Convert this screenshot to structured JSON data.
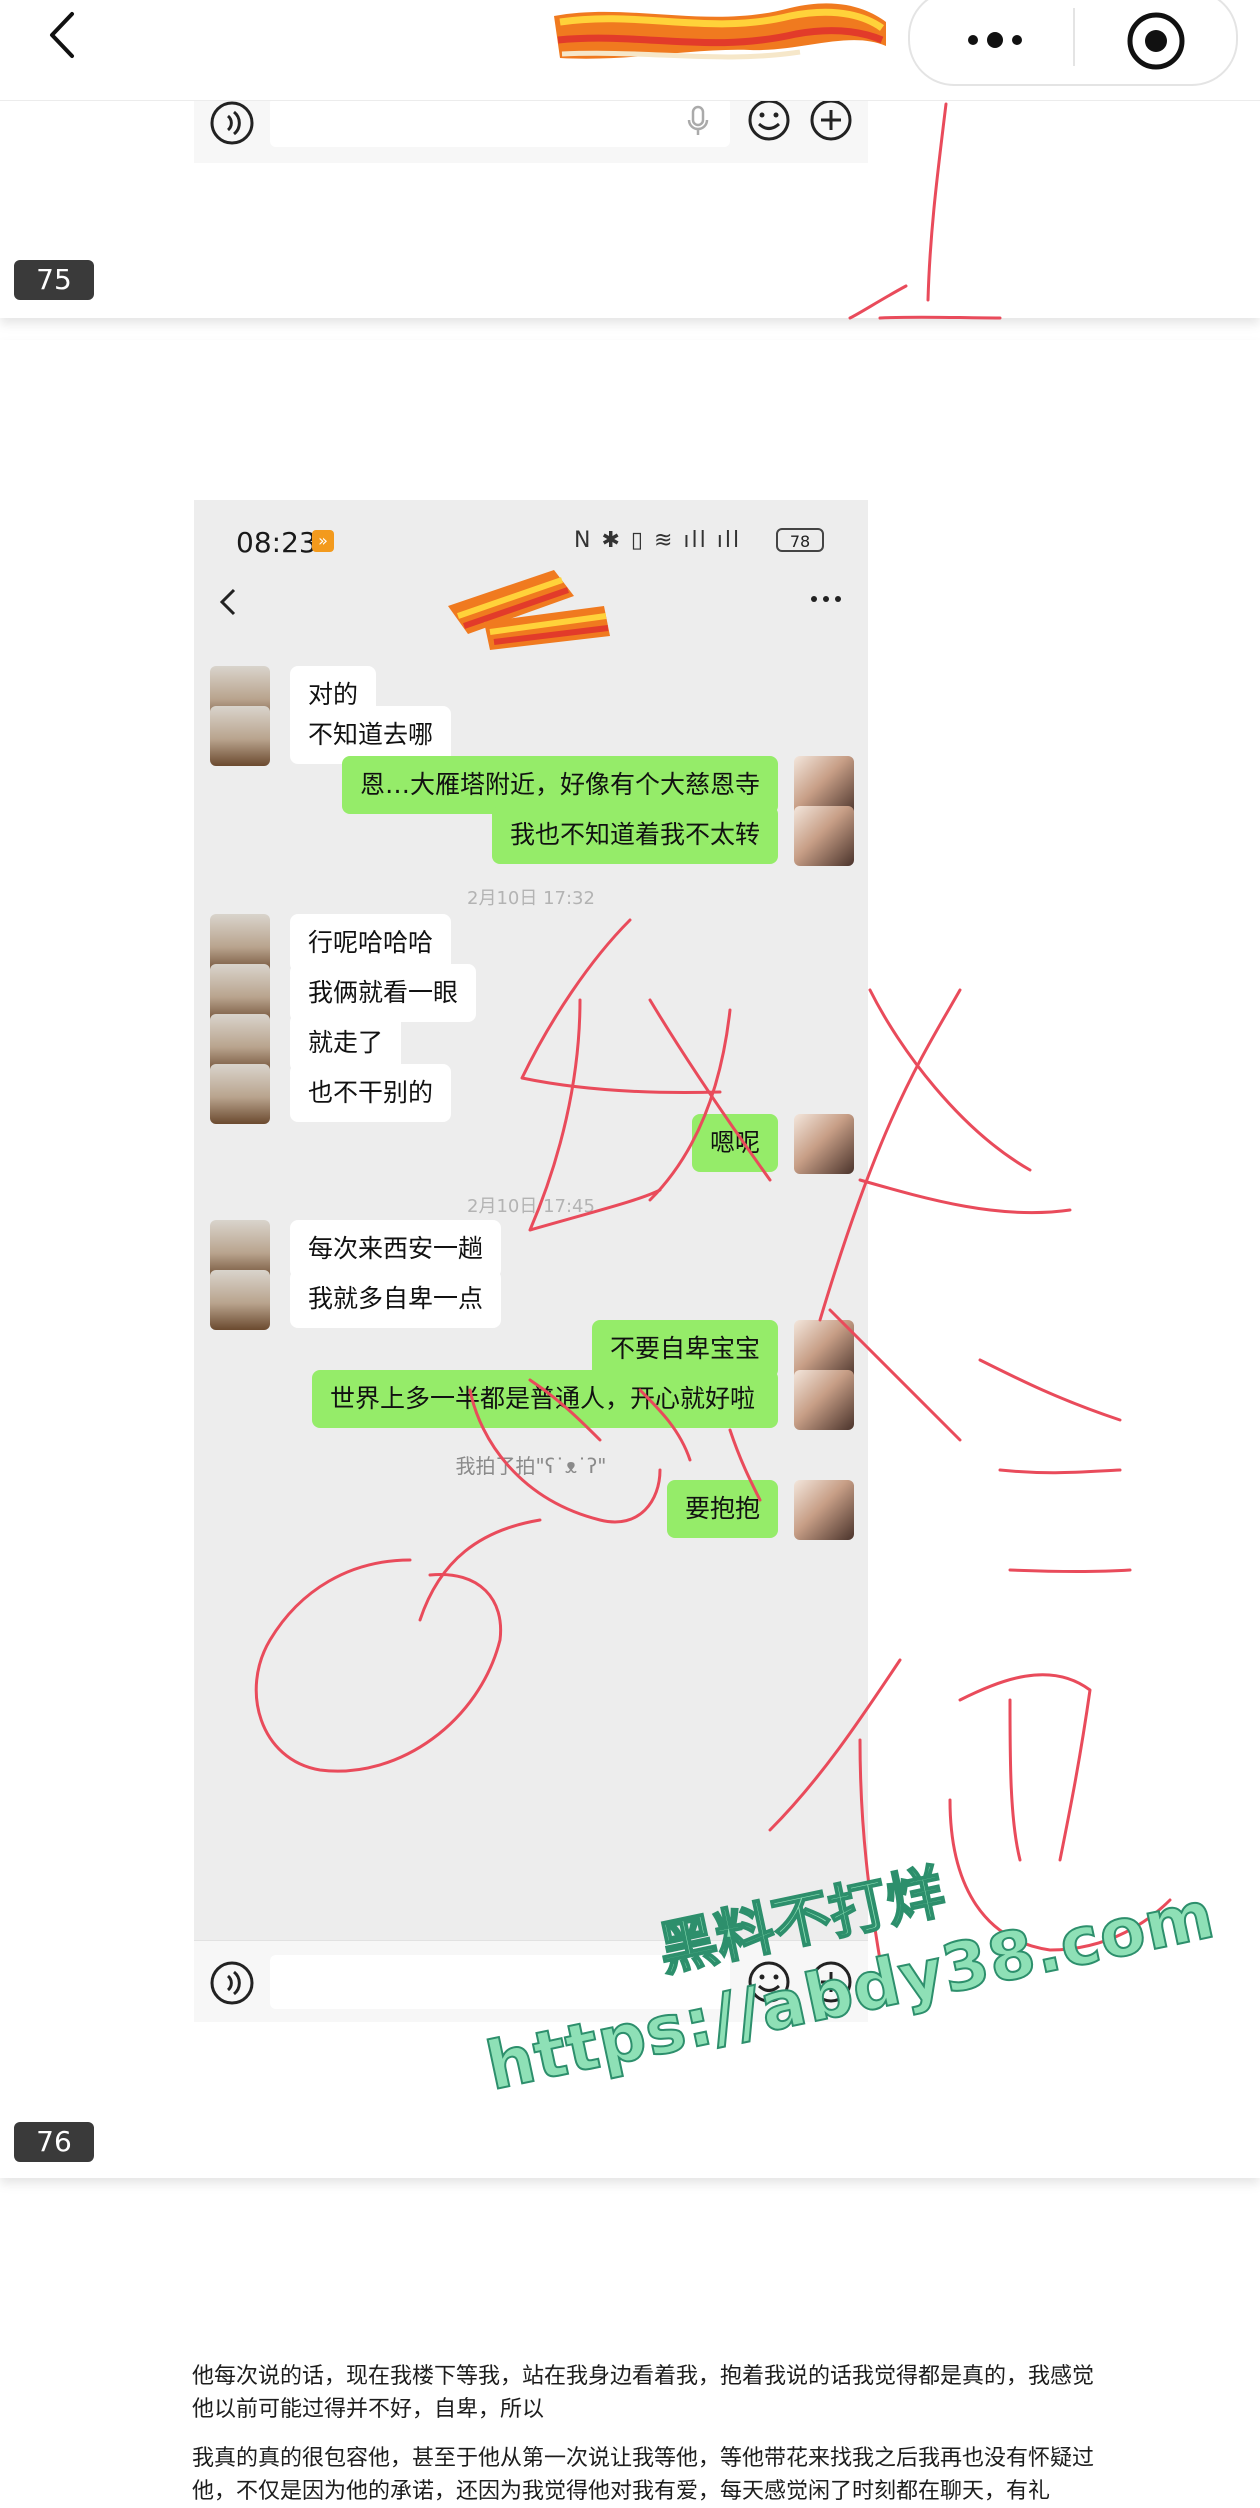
{
  "nav": {
    "back_icon": "chevron-left-icon",
    "more_icon": "more-dots-icon",
    "target_icon": "target-circle-icon"
  },
  "slide75": {
    "page_number": "75"
  },
  "slide76": {
    "page_number": "76",
    "status_time": "08:23",
    "status_icons": "N ✱ ▯ ≋ ıll ıll",
    "battery": "78",
    "messages": [
      {
        "side": "other",
        "text": "对的"
      },
      {
        "side": "other",
        "text": "不知道去哪"
      },
      {
        "side": "self",
        "text": "恩…大雁塔附近，好像有个大慈恩寺"
      },
      {
        "side": "self",
        "text": "我也不知道着我不太转"
      },
      {
        "type": "time",
        "text": "2月10日 17:32"
      },
      {
        "side": "other",
        "text": "行呢哈哈哈"
      },
      {
        "side": "other",
        "text": "我俩就看一眼"
      },
      {
        "side": "other",
        "text": "就走了"
      },
      {
        "side": "other",
        "text": "也不干别的"
      },
      {
        "side": "self",
        "text": "嗯呢"
      },
      {
        "type": "time",
        "text": "2月10日 17:45"
      },
      {
        "side": "other",
        "text": "每次来西安一趟"
      },
      {
        "side": "other",
        "text": "我就多自卑一点"
      },
      {
        "side": "self",
        "text": "不要自卑宝宝"
      },
      {
        "side": "self",
        "text": "世界上多一半都是普通人，开心就好啦"
      },
      {
        "type": "pat",
        "text": "我拍了拍\"ʕ˙ᴥ˙ʔ\""
      },
      {
        "side": "self",
        "text": "要抱抱"
      }
    ]
  },
  "watermark": {
    "line1": "黑料不打烊",
    "line2": "https://abdy38.com"
  },
  "article": {
    "p1": "他每次说的话，现在我楼下等我，站在我身边看着我，抱着我说的话我觉得都是真的，我感觉他以前可能过得并不好，自卑，所以",
    "p2": "我真的真的很包容他，甚至于他从第一次说让我等他，等他带花来找我之后我再也没有怀疑过他，不仅是因为他的承诺，还因为我觉得他对我有爱，每天感觉闲了时刻都在聊天，有礼"
  },
  "colors": {
    "bubble_green": "#95ec69",
    "chat_bg": "#ededed",
    "doodle_red": "#e94b5b",
    "watermark_fill": "#8ee0b6"
  }
}
